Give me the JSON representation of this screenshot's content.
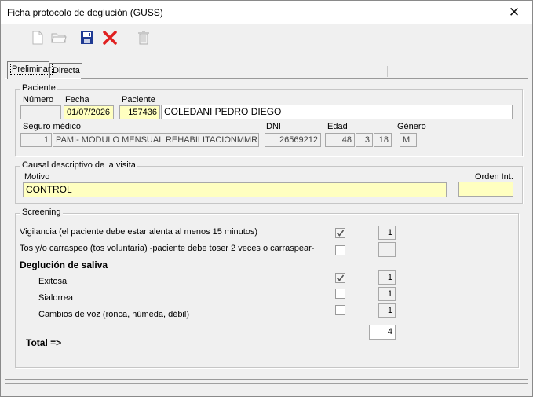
{
  "window": {
    "title": "Ficha protocolo de deglución (GUSS)",
    "close_glyph": "✕"
  },
  "toolbar": {
    "new_icon": "new-document-icon",
    "open_icon": "open-folder-icon",
    "save_icon": "save-disk-icon",
    "cancel_icon": "red-x-icon",
    "delete_icon": "trash-icon"
  },
  "tabs": [
    {
      "label": "Preliminar"
    },
    {
      "label": "Directa"
    }
  ],
  "paciente_group": {
    "legend": "Paciente",
    "numero_label": "Número",
    "numero_value": "",
    "fecha_label": "Fecha",
    "fecha_value": "01/07/2026",
    "paciente_label": "Paciente",
    "paciente_id": "157436",
    "paciente_name": "COLEDANI PEDRO DIEGO",
    "seguro_label": "Seguro médico",
    "seguro_code": "1",
    "seguro_name": "PAMI- MODULO MENSUAL REHABILITACIONMMRI",
    "dni_label": "DNI",
    "dni_value": "26569212",
    "edad_label": "Edad",
    "edad_years": "48",
    "edad_months": "3",
    "edad_days": "18",
    "genero_label": "Género",
    "genero_value": "M"
  },
  "causal_group": {
    "legend": "Causal descriptivo de la visita",
    "motivo_label": "Motivo",
    "motivo_value": "CONTROL",
    "orden_label": "Orden Int.",
    "orden_value": ""
  },
  "screening": {
    "legend": "Screening",
    "vigilancia_label": "Vigilancia (el paciente debe estar alenta al menos 15 minutos)",
    "vigilancia_checked": true,
    "vigilancia_score": "1",
    "tos_label": "Tos y/o carraspeo (tos voluntaria) -paciente debe toser 2 veces o carraspear-",
    "tos_checked": false,
    "tos_score": "",
    "deglucion_heading": "Deglución de saliva",
    "exitosa_label": "Exitosa",
    "exitosa_checked": true,
    "exitosa_score": "1",
    "sialorrea_label": "Sialorrea",
    "sialorrea_checked": false,
    "sialorrea_score": "1",
    "cambios_label": "Cambios de voz (ronca, húmeda, débil)",
    "cambios_checked": false,
    "cambios_score": "1",
    "total_label": "Total =>",
    "total_value": "4"
  },
  "colors": {
    "highlight_field": "#ffffc0",
    "delete_red": "#e02020",
    "save_blue": "#1f3a93"
  }
}
